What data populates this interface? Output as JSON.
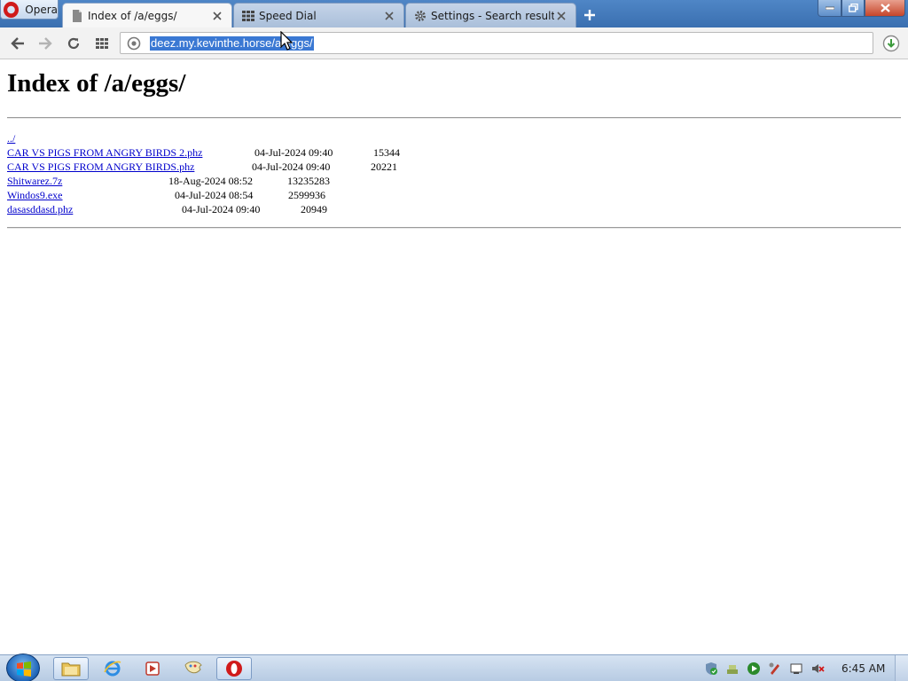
{
  "browser": {
    "menu_label": "Opera",
    "tabs": [
      {
        "label": "Index of /a/eggs/",
        "icon": "document-icon"
      },
      {
        "label": "Speed Dial",
        "icon": "grid-icon"
      },
      {
        "label": "Settings - Search results",
        "icon": "gear-icon"
      }
    ],
    "address": "deez.my.kevinthe.horse/a/eggs/"
  },
  "page": {
    "title": "Index of /a/eggs/",
    "parent_link": "../",
    "files": [
      {
        "name": "CAR VS PIGS FROM ANGRY BIRDS 2.phz",
        "date": "04-Jul-2024 09:40",
        "size": "15344"
      },
      {
        "name": "CAR VS PIGS FROM ANGRY BIRDS.phz",
        "date": "04-Jul-2024 09:40",
        "size": "20221"
      },
      {
        "name": "Shitwarez.7z",
        "date": "18-Aug-2024 08:52",
        "size": "13235283"
      },
      {
        "name": "Windos9.exe",
        "date": "04-Jul-2024 08:54",
        "size": "2599936"
      },
      {
        "name": "dasasddasd.phz",
        "date": "04-Jul-2024 09:40",
        "size": "20949"
      }
    ]
  },
  "taskbar": {
    "clock": "6:45 AM"
  },
  "colors": {
    "link": "#0000cc",
    "selection": "#3a78d3",
    "opera_red": "#d01a1a"
  }
}
